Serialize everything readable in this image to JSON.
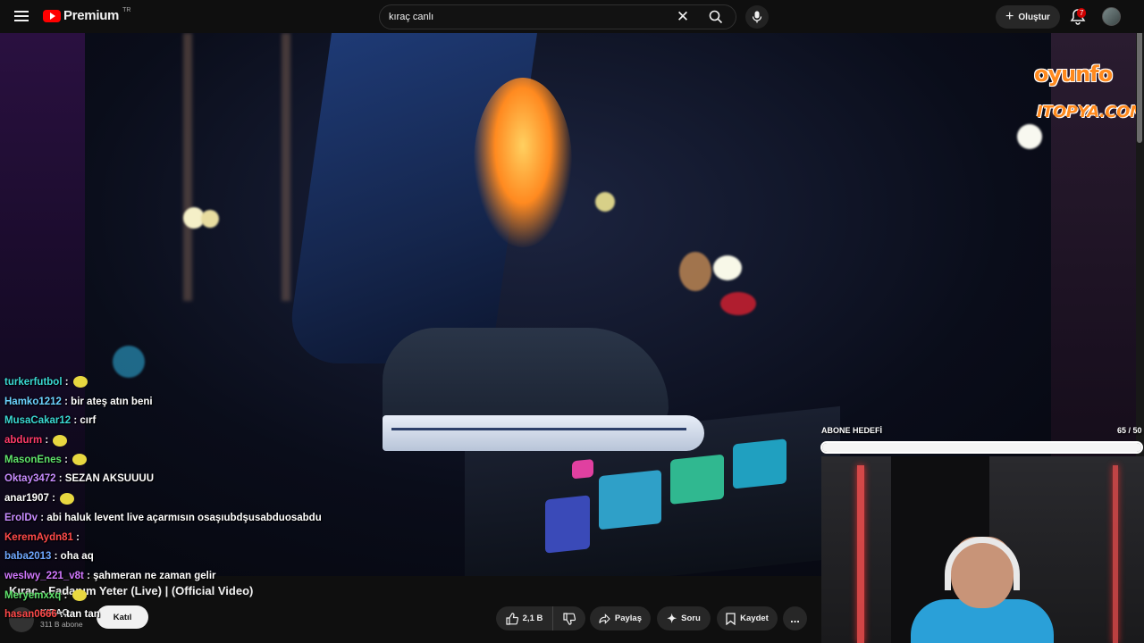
{
  "topbar": {
    "logo_text": "Premium",
    "logo_region": "TR",
    "search_value": "kıraç canlı",
    "create_label": "Oluştur",
    "notification_count": "7"
  },
  "overlay": {
    "brand_top": "oyunfo",
    "brand_bottom": "ITOPYA.COM",
    "goal_label": "ABONE HEDEFİ",
    "goal_count": "65 / 50",
    "goal_progress": 1.0
  },
  "chat": [
    {
      "user": "turkerfutbol",
      "msg": "",
      "color": "#3ad7d2",
      "emote": true
    },
    {
      "user": "Hamko1212",
      "msg": "bir ateş atın beni",
      "color": "#6cd3ff",
      "emote": false
    },
    {
      "user": "MusaCakar12",
      "msg": "cırf",
      "color": "#3ad7d2",
      "emote": false
    },
    {
      "user": "abdurm",
      "msg": "",
      "color": "#ff3b6b",
      "emote": true
    },
    {
      "user": "MasonEnes",
      "msg": "",
      "color": "#5fe36b",
      "emote": true
    },
    {
      "user": "Oktay3472",
      "msg": "SEZAN AKSUUUU",
      "color": "#c88cff",
      "emote": false
    },
    {
      "user": "anar1907",
      "msg": "",
      "color": "#ffffff",
      "emote": true
    },
    {
      "user": "ErolDv",
      "msg": "abi haluk levent live açarmısın osaşıubdşusabduosabdu",
      "color": "#c88cff",
      "emote": false
    },
    {
      "user": "KeremAydn81",
      "msg": "",
      "color": "#ff4a4a",
      "emote": false
    },
    {
      "user": "baba2013",
      "msg": "oha aq",
      "color": "#6fa8ff",
      "emote": false
    },
    {
      "user": "weslwy_221_v8t",
      "msg": "şahmeran ne zaman gelir",
      "color": "#d278ff",
      "emote": false
    },
    {
      "user": "Meryemxxq",
      "msg": "",
      "color": "#5fe36b",
      "emote": true
    },
    {
      "user": "hasan0666",
      "msg": "tan tan",
      "color": "#ff4a4a",
      "emote": false
    }
  ],
  "video": {
    "title": "Kıraç - Fadanım Yeter (Live) | (Official Video)",
    "channel_name": "KIRAÇ",
    "channel_subs": "311 B abone",
    "join_label": "Katıl",
    "like_count": "2,1 B",
    "share_label": "Paylaş",
    "ask_label": "Soru",
    "save_label": "Kaydet",
    "more_label": "..."
  }
}
